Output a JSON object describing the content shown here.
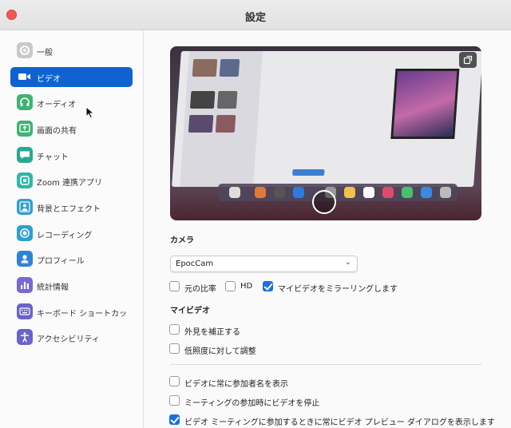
{
  "window": {
    "title": "設定"
  },
  "sidebar": {
    "items": [
      {
        "label": "一般",
        "icon": "gear-icon",
        "color": "#c9c9c9"
      },
      {
        "label": "ビデオ",
        "icon": "video-camera-icon",
        "color": "#0e63d1",
        "active": true
      },
      {
        "label": "オーディオ",
        "icon": "headphones-icon",
        "color": "#3fb372"
      },
      {
        "label": "画面の共有",
        "icon": "screen-share-icon",
        "color": "#3fb372"
      },
      {
        "label": "チャット",
        "icon": "chat-bubble-icon",
        "color": "#2aa88f"
      },
      {
        "label": "Zoom 連携アプリ",
        "icon": "apps-icon",
        "color": "#30b6a8"
      },
      {
        "label": "背景とエフェクト",
        "icon": "person-background-icon",
        "color": "#2f9fcf"
      },
      {
        "label": "レコーディング",
        "icon": "record-icon",
        "color": "#2f9fcf"
      },
      {
        "label": "プロフィール",
        "icon": "profile-icon",
        "color": "#2f84d6"
      },
      {
        "label": "統計情報",
        "icon": "bar-chart-icon",
        "color": "#7a67cf"
      },
      {
        "label": "キーボード ショートカッ",
        "icon": "keyboard-icon",
        "color": "#6a63c8"
      },
      {
        "label": "アクセシビリティ",
        "icon": "accessibility-icon",
        "color": "#6a63c8"
      }
    ]
  },
  "camera": {
    "section_label": "カメラ",
    "selected": "EpocCam",
    "options": [
      {
        "label": "元の比率",
        "checked": false
      },
      {
        "label": "HD",
        "checked": false
      },
      {
        "label": "マイビデオをミラーリングします",
        "checked": true
      }
    ]
  },
  "my_video": {
    "section_label": "マイビデオ",
    "options": [
      {
        "label": "外見を補正する",
        "checked": false
      },
      {
        "label": "低照度に対して調整",
        "checked": false
      }
    ]
  },
  "general_options": [
    {
      "label": "ビデオに常に参加者名を表示",
      "checked": false
    },
    {
      "label": "ミーティングの参加時にビデオを停止",
      "checked": false
    },
    {
      "label": "ビデオ ミーティングに参加するときに常にビデオ プレビュー ダイアログを表示します",
      "checked": true
    }
  ],
  "colors": {
    "accent": "#0e63d1",
    "checkbox": "#1a6fe0"
  }
}
